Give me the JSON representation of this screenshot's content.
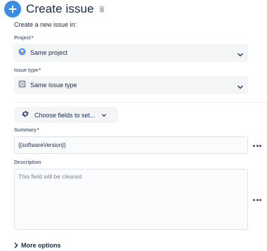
{
  "header": {
    "title": "Create issue"
  },
  "intro_text": "Create a new issue in:",
  "project": {
    "label": "Project",
    "required_marker": "*",
    "value": "Same project"
  },
  "issue_type": {
    "label": "Issue type",
    "required_marker": "*",
    "value": "Same issue type"
  },
  "choose_fields_button": {
    "label": "Choose fields to set..."
  },
  "summary": {
    "label": "Summary",
    "required_marker": "*",
    "value": "{{softwareVersion}}"
  },
  "description": {
    "label": "Description",
    "placeholder": "This field will be cleared"
  },
  "more_options": {
    "label": "More options"
  },
  "colors": {
    "accent": "#3b8de3",
    "required": "#de350b",
    "field_bg": "#f4f5f7",
    "text": "#172b4d",
    "muted": "#5e6c84"
  }
}
